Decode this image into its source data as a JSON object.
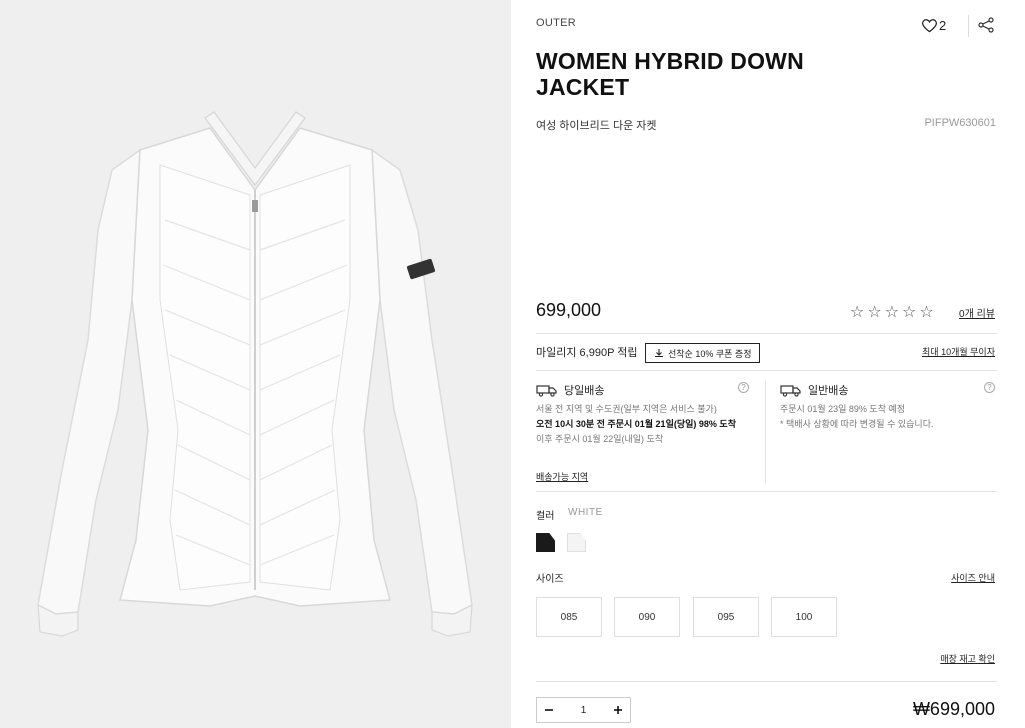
{
  "product": {
    "category": "OUTER",
    "title": "WOMEN HYBRID DOWN JACKET",
    "subtitle_ko": "여성 하이브리드 다운 자켓",
    "sku": "PIFPW630601",
    "like_count": "2",
    "price": "699,000",
    "rating_stars": 0,
    "reviews_link": "0개 리뷰"
  },
  "benefits": {
    "mileage": "마일리지 6,990P 적립",
    "coupon_button": "선착순 10% 쿠폰 증정",
    "installment_link": "최대 10개월 무이자"
  },
  "shipping": {
    "same_day": {
      "title": "당일배송",
      "area": "서울 전 지역 및 수도권(일부 지역은 서비스 불가)",
      "cutoff": "오전 10시 30분 전 주문시 01월 21일(당일) 98% 도착",
      "after": "이후 주문시 01월 22일(내일) 도착",
      "area_link": "배송가능 지역"
    },
    "standard": {
      "title": "일반배송",
      "eta": "주문시 01월 23일 89% 도착 예정",
      "note": "* 택배사 상황에 따라 변경될 수 있습니다."
    }
  },
  "options": {
    "color_label": "컬러",
    "color_value": "WHITE",
    "colors": [
      "black",
      "white"
    ],
    "size_label": "사이즈",
    "size_guide": "사이즈 안내",
    "sizes": [
      "085",
      "090",
      "095",
      "100"
    ],
    "stock_link": "매장 재고 확인"
  },
  "order": {
    "quantity": "1",
    "total": "₩699,000"
  },
  "colors": {
    "text": "#111111",
    "border": "#e4e4e4",
    "gallery_bg": "#efefef"
  }
}
